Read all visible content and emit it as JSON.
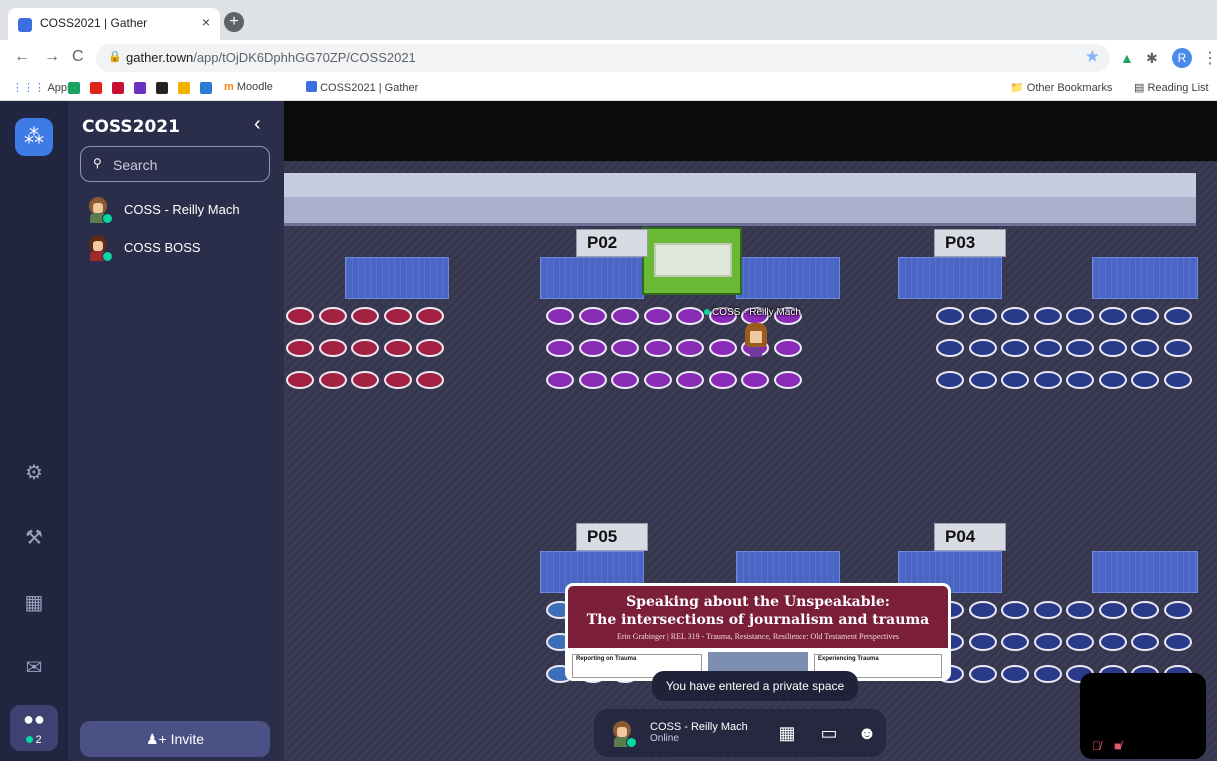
{
  "browser": {
    "tab_title": "COSS2021 | Gather",
    "tab_close": "×",
    "new_tab": "+",
    "back": "←",
    "forward": "→",
    "reload": "C",
    "url_host": "gather.town",
    "url_path": "/app/tOjDK6DphhGG70ZP/COSS2021",
    "star": "★",
    "profile_initial": "R",
    "menu": "⋮"
  },
  "bookmarks": {
    "apps": "Apps",
    "moodle": "Moodle",
    "gather": "COSS2021 | Gather",
    "other": "Other Bookmarks",
    "reading_list": "Reading List"
  },
  "sidebar": {
    "space_name": "COSS2021",
    "collapse": "‹",
    "search_placeholder": "Search",
    "members": [
      {
        "name": "COSS - Reilly Mach"
      },
      {
        "name": "COSS BOSS"
      }
    ],
    "invite_label": "Invite",
    "people_count": "2"
  },
  "map": {
    "pods": [
      "P02",
      "P03",
      "P05",
      "P04"
    ],
    "player_name": "COSS - Reilly Mach"
  },
  "slide": {
    "title_line1": "Speaking about the Unspeakable:",
    "title_line2": "The intersections of journalism and trauma",
    "subtitle": "Erin Grabinger  |  REL 319 - Trauma, Resistance, Resilience: Old Testament Perspectives",
    "card_left": "Reporting on Trauma",
    "card_right": "Experiencing Trauma"
  },
  "toast": "You have entered a private space",
  "bottombar": {
    "name": "COSS - Reilly Mach",
    "status": "Online"
  },
  "colors": {
    "app_bg": "#2a2d49",
    "accent": "#3e7be5",
    "online": "#06d6a0",
    "slide_band": "#7b1e3a"
  }
}
